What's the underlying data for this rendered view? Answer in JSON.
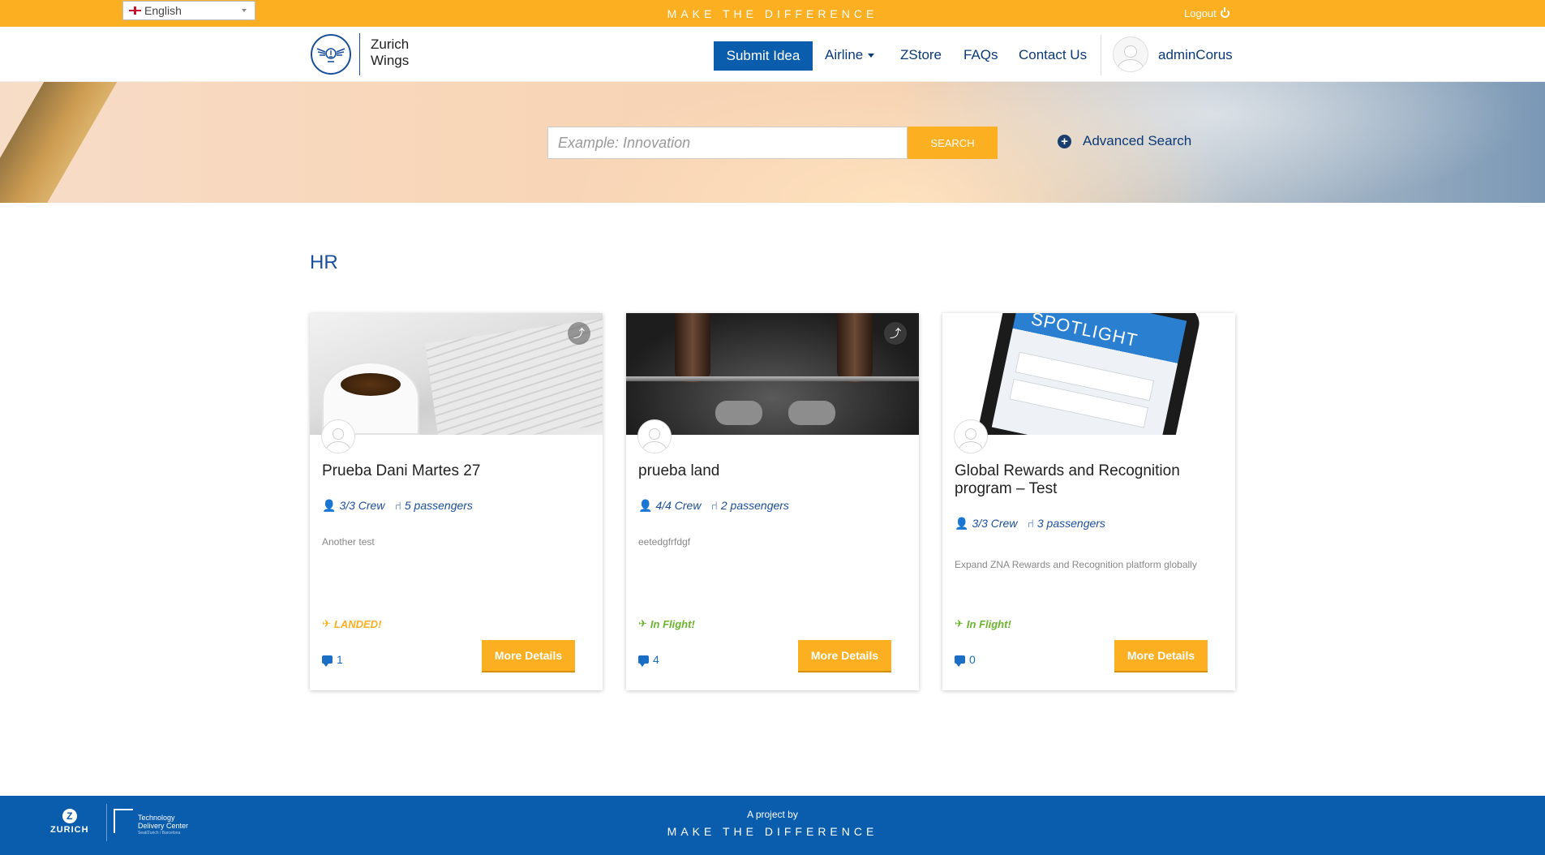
{
  "topbar": {
    "language": "English",
    "tagline": "MAKE THE DIFFERENCE",
    "logout": "Logout"
  },
  "header": {
    "brand_line1": "Zurich",
    "brand_line2": "Wings",
    "nav": {
      "submit": "Submit Idea",
      "airline": "Airline",
      "zstore": "ZStore",
      "faqs": "FAQs",
      "contact": "Contact Us"
    },
    "username": "adminCorus"
  },
  "search": {
    "placeholder": "Example: Innovation",
    "button": "SEARCH",
    "advanced": "Advanced Search"
  },
  "section": {
    "title": "HR"
  },
  "cards": [
    {
      "title": "Prueba Dani Martes 27",
      "crew": "3/3 Crew",
      "passengers": "5 passengers",
      "description": "Another test",
      "status": "LANDED!",
      "comments": "1",
      "button": "More Details"
    },
    {
      "title": "prueba land",
      "crew": "4/4 Crew",
      "passengers": "2 passengers",
      "description": "eetedgfrfdgf",
      "status": "In Flight!",
      "comments": "4",
      "button": "More Details"
    },
    {
      "title": "Global Rewards and Recognition program – Test",
      "crew": "3/3 Crew",
      "passengers": "3 passengers",
      "description": "Expand ZNA Rewards and Recognition platform globally",
      "status": "In Flight!",
      "comments": "0",
      "button": "More Details"
    }
  ],
  "footer": {
    "zurich": "ZURICH",
    "tdc_line1": "Technology",
    "tdc_line2": "Delivery Center",
    "tdc_sub": "Seat/Zurich / Barcelona",
    "project_by": "A project by",
    "tagline": "MAKE THE DIFFERENCE"
  },
  "colors": {
    "accent": "#fbaf21",
    "brand_blue": "#0a5cad",
    "landed": "#fbaf21",
    "in_flight": "#6ab42d"
  },
  "icons": [
    "uk-flag-icon",
    "power-icon",
    "zurich-wings-logo",
    "plus-circle-icon",
    "share-icon",
    "crew-icon",
    "seat-icon",
    "landing-icon",
    "takeoff-icon",
    "comment-icon",
    "avatar-icon"
  ]
}
